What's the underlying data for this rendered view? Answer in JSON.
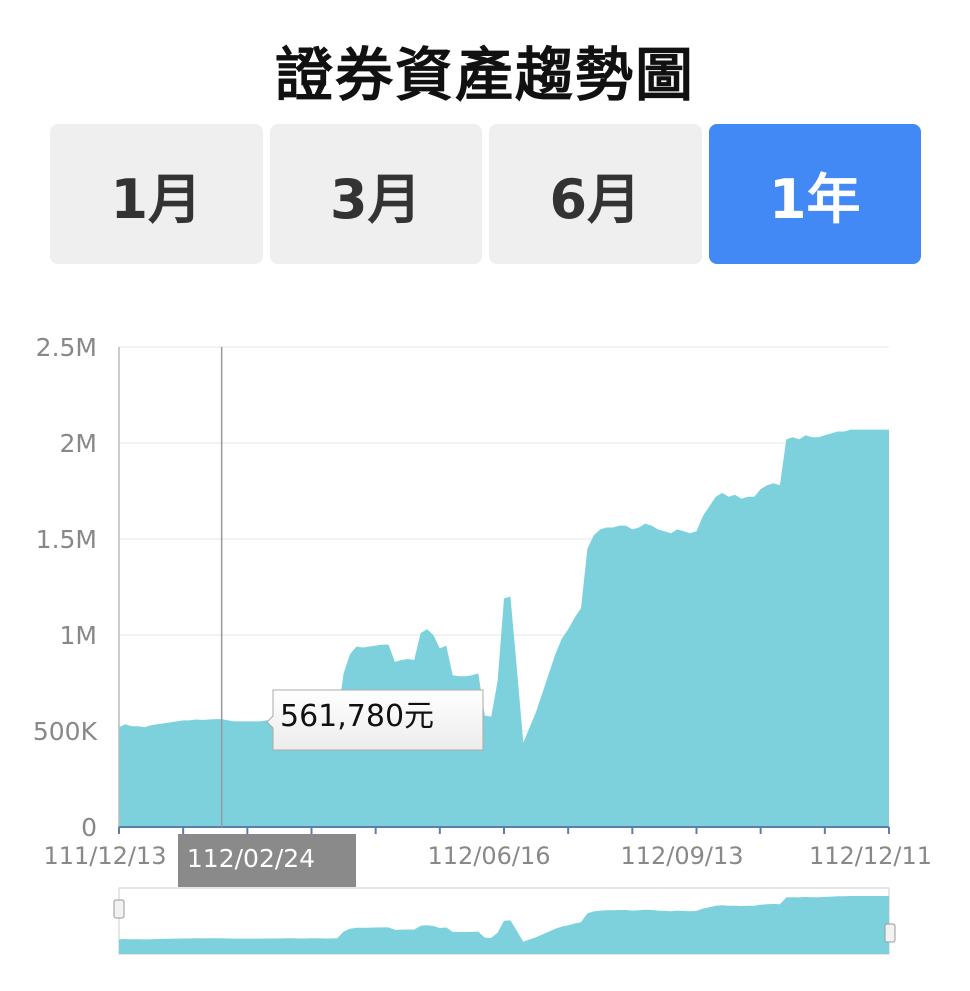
{
  "title": "證券資產趨勢圖",
  "tabs": [
    {
      "label": "1月",
      "active": false
    },
    {
      "label": "3月",
      "active": false
    },
    {
      "label": "6月",
      "active": false
    },
    {
      "label": "1年",
      "active": true
    }
  ],
  "colors": {
    "area": "#7dd1dd",
    "active_tab": "#4289f6",
    "tab_bg": "#efefef",
    "badge": "#8a8a8a"
  },
  "chart_data": {
    "type": "area",
    "ylim": [
      0,
      2500000
    ],
    "y_ticks": [
      0,
      500000,
      1000000,
      1500000,
      2000000,
      2500000
    ],
    "y_tick_labels": [
      "0",
      "500K",
      "1M",
      "1.5M",
      "2M",
      "2.5M"
    ],
    "x_tick_labels": [
      "111/12/13",
      "112/06/16",
      "112/09/13",
      "112/12/11"
    ],
    "tooltip": {
      "date": "112/02/24",
      "value": 561780,
      "label": "561,780元"
    },
    "grid": true,
    "legend": "none",
    "series": [
      {
        "x": [
          0,
          3,
          6,
          9,
          12,
          15,
          18,
          21,
          24,
          27,
          30,
          33,
          36,
          39,
          42,
          45,
          48,
          51,
          54,
          57,
          60,
          63,
          66,
          69,
          72,
          75,
          78,
          81,
          84,
          87,
          90,
          93,
          96,
          99,
          102,
          105,
          108,
          111,
          114,
          117,
          120,
          123,
          126,
          129,
          132,
          135,
          138,
          141,
          144,
          147,
          150,
          153,
          156,
          159,
          162,
          165,
          168,
          171,
          174,
          177,
          180,
          183,
          186,
          189,
          192,
          195,
          198,
          201,
          204,
          207,
          210,
          213,
          216,
          219,
          222,
          225,
          228,
          231,
          234,
          237,
          240,
          243,
          246,
          249,
          252,
          255,
          258,
          261,
          264,
          267,
          270,
          273,
          276,
          279,
          282,
          285,
          288,
          291,
          294,
          297,
          300,
          303,
          306,
          309,
          312,
          315,
          318,
          321,
          324,
          327,
          330,
          333,
          336,
          339,
          342,
          345,
          348,
          351,
          354,
          357,
          360
        ],
        "values": [
          520000,
          535000,
          525000,
          525000,
          520000,
          530000,
          535000,
          540000,
          545000,
          550000,
          555000,
          555000,
          560000,
          558000,
          560000,
          562000,
          561780,
          555000,
          550000,
          550000,
          550000,
          550000,
          550000,
          555000,
          555000,
          555000,
          560000,
          560000,
          555000,
          555000,
          560000,
          560000,
          555000,
          555000,
          560000,
          800000,
          900000,
          940000,
          935000,
          940000,
          945000,
          950000,
          950000,
          860000,
          870000,
          875000,
          870000,
          1010000,
          1030000,
          1000000,
          930000,
          945000,
          790000,
          785000,
          785000,
          790000,
          800000,
          580000,
          575000,
          760000,
          1190000,
          1200000,
          830000,
          440000,
          520000,
          600000,
          700000,
          800000,
          900000,
          980000,
          1030000,
          1090000,
          1140000,
          1450000,
          1520000,
          1550000,
          1560000,
          1560000,
          1570000,
          1570000,
          1550000,
          1560000,
          1580000,
          1570000,
          1550000,
          1540000,
          1530000,
          1550000,
          1540000,
          1530000,
          1540000,
          1620000,
          1670000,
          1720000,
          1740000,
          1720000,
          1730000,
          1710000,
          1720000,
          1720000,
          1760000,
          1780000,
          1790000,
          1780000,
          2020000,
          2030000,
          2020000,
          2040000,
          2030000,
          2030000,
          2040000,
          2050000,
          2060000,
          2060000,
          2070000,
          2070000,
          2070000,
          2070000,
          2070000,
          2070000,
          2070000
        ]
      }
    ]
  }
}
